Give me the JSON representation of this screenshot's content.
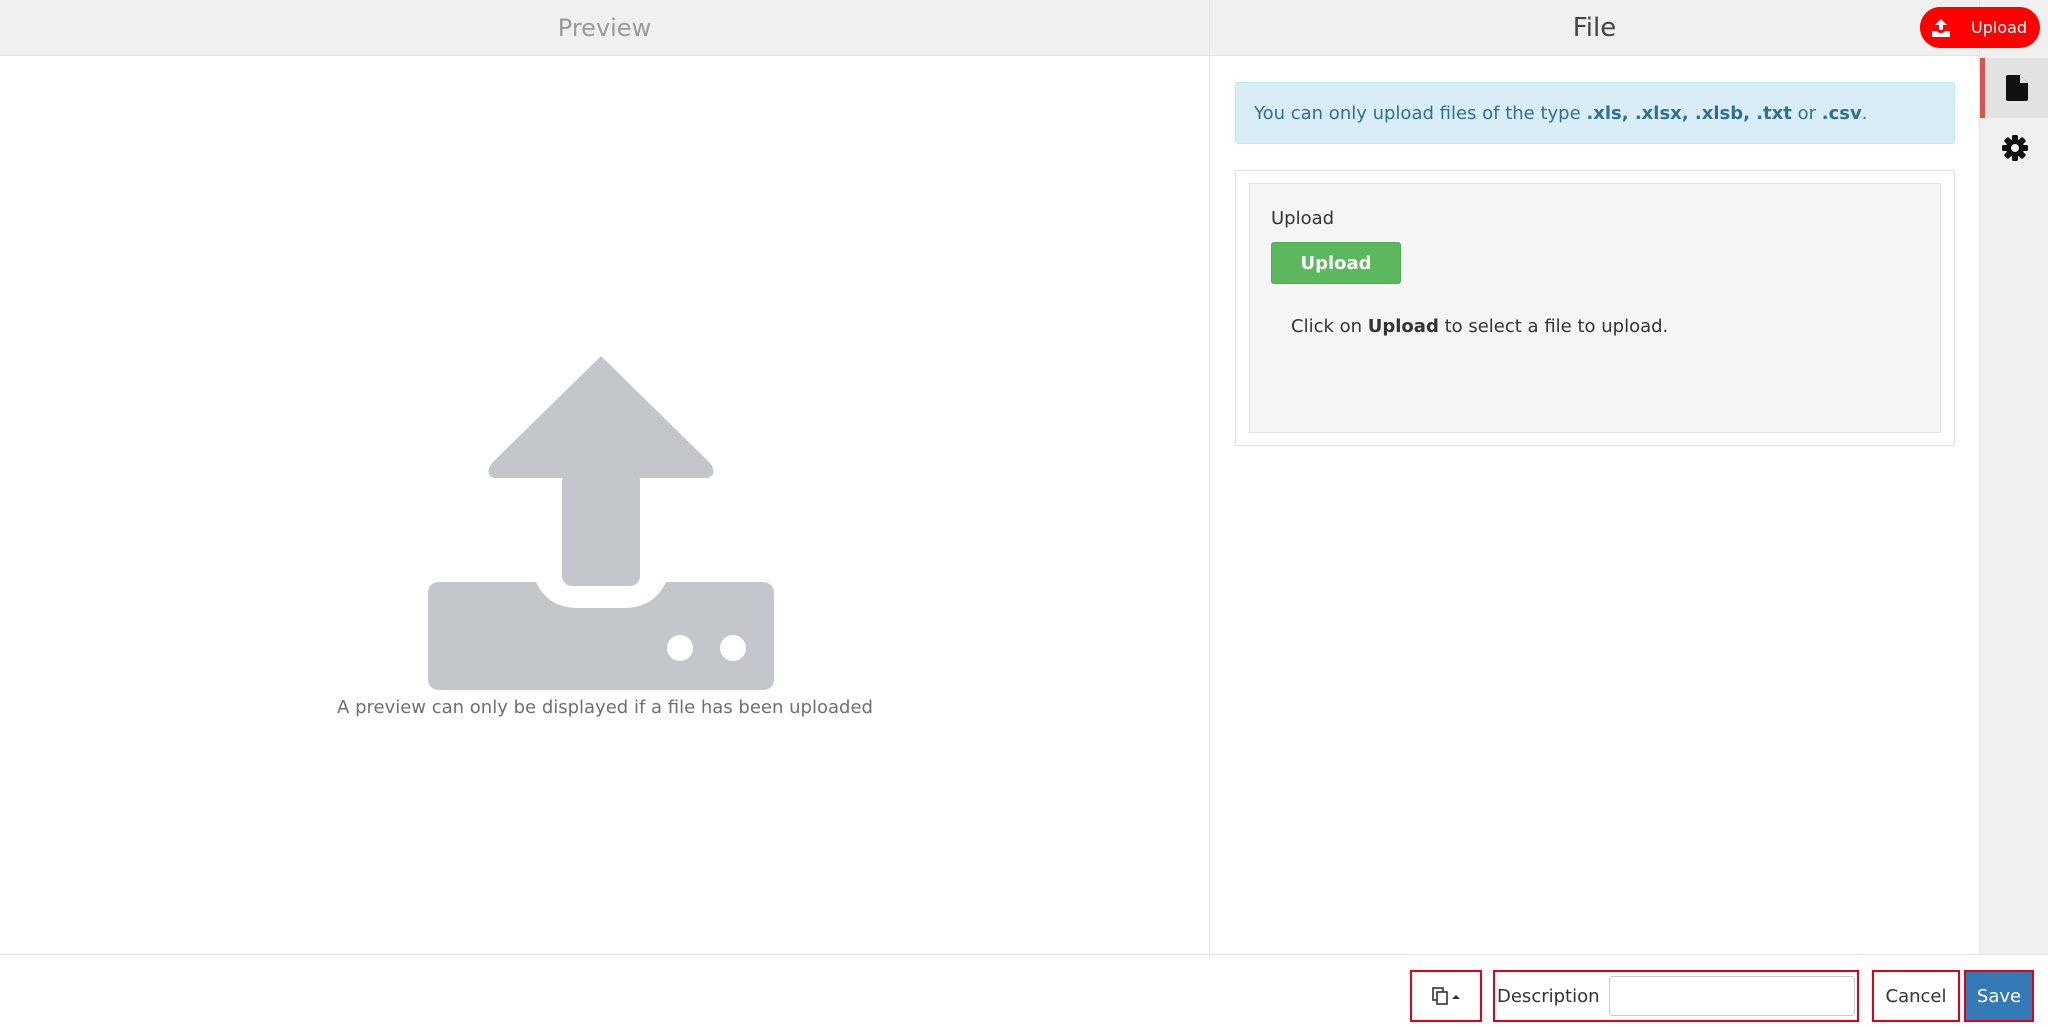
{
  "preview": {
    "title": "Preview",
    "note": "A preview can only be displayed if a file has been uploaded"
  },
  "file_panel": {
    "title": "File",
    "alert": {
      "prefix": "You can only upload files of the type ",
      "types": ".xls, .xlsx, .xlsb, .txt",
      "or": " or ",
      "last_type": ".csv",
      "suffix": "."
    },
    "upload_section": {
      "label": "Upload",
      "button_label": "Upload",
      "help_prefix": "Click on ",
      "help_bold": "Upload",
      "help_suffix": " to select a file to upload."
    }
  },
  "top_action": {
    "label": "Upload",
    "color": "#ff0000"
  },
  "side_tabs": [
    {
      "icon": "file-icon",
      "active": true
    },
    {
      "icon": "gear-icon",
      "active": false
    }
  ],
  "footer": {
    "description_label": "Description",
    "description_value": "",
    "cancel_label": "Cancel",
    "save_label": "Save"
  },
  "colors": {
    "accent_blue": "#337ab7",
    "success_green": "#5cb85c",
    "info_bg": "#d9edf7",
    "info_text": "#31708f",
    "highlight_red": "#e0001b"
  }
}
